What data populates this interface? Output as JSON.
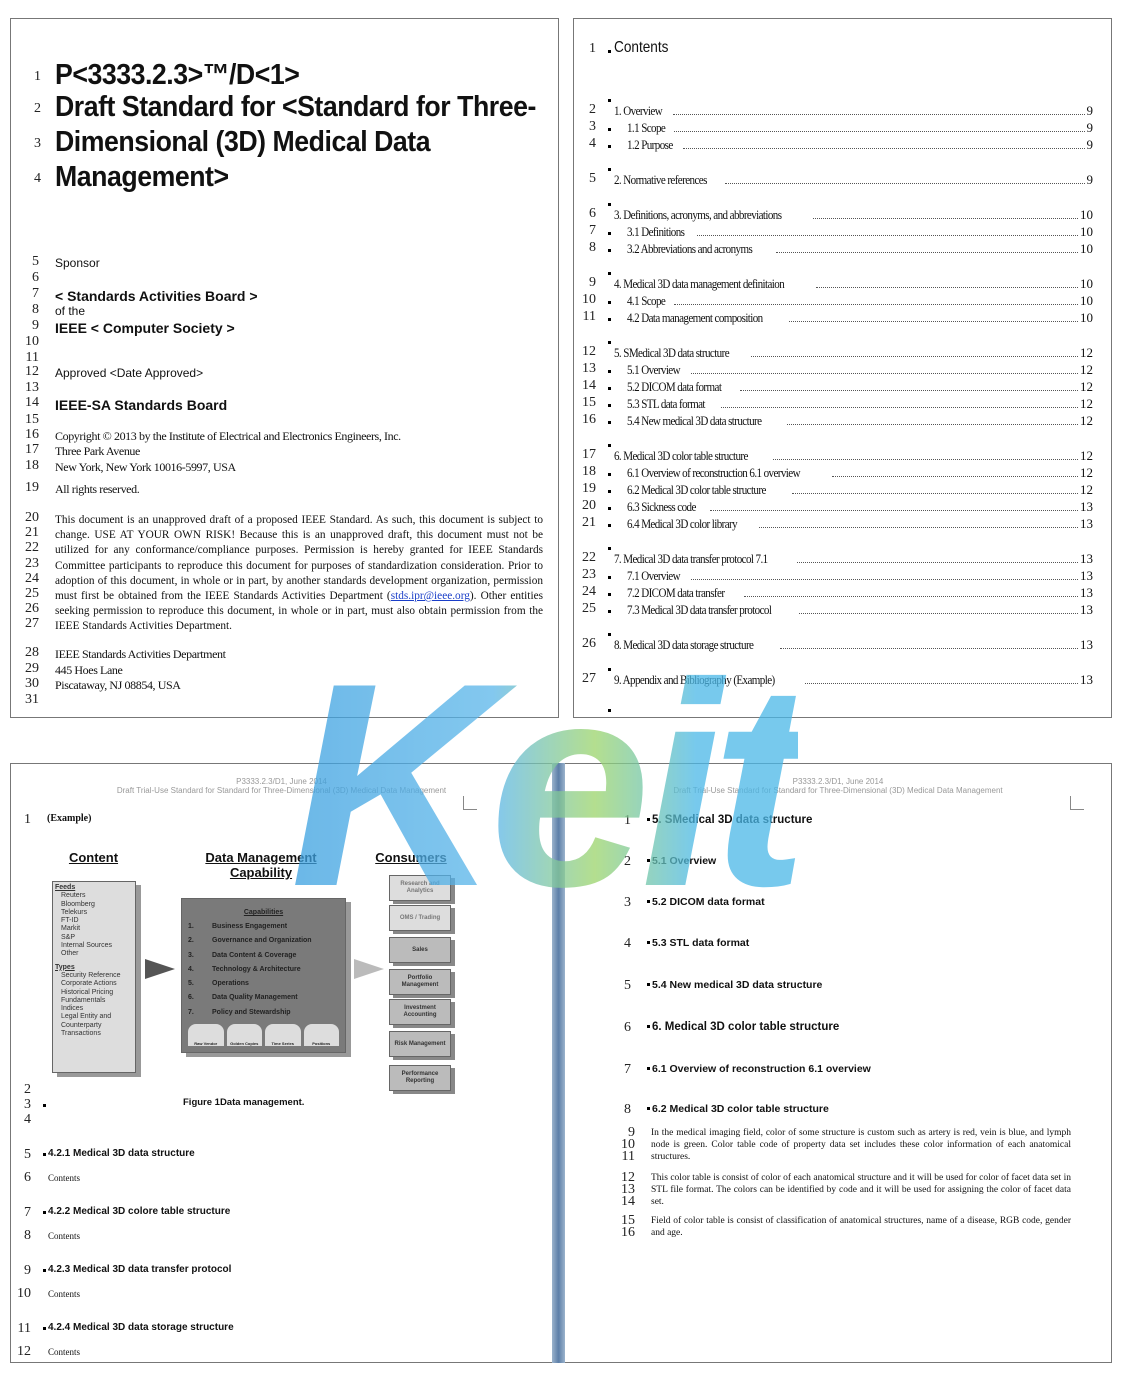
{
  "watermark": {
    "text": "Keit",
    "repeat_text": "KEIT"
  },
  "page1": {
    "title_lines": [
      "P<3333.2.3>™/D<1>",
      "Draft Standard for <Standard for Three-",
      "Dimensional (3D) Medical Data",
      "Management>"
    ],
    "lines": [
      {
        "n": "5",
        "t": "Sponsor"
      },
      {
        "n": "6",
        "t": ""
      },
      {
        "n": "7",
        "t": "< Standards Activities Board >"
      },
      {
        "n": "8",
        "t": "of the"
      },
      {
        "n": "9",
        "t": "IEEE < Computer Society >"
      },
      {
        "n": "10",
        "t": ""
      },
      {
        "n": "11",
        "t": ""
      },
      {
        "n": "12",
        "t": "Approved <Date Approved>"
      },
      {
        "n": "13",
        "t": ""
      },
      {
        "n": "14",
        "t": "IEEE-SA Standards Board"
      },
      {
        "n": "15",
        "t": ""
      },
      {
        "n": "16",
        "t": "Copyright © 2013 by the Institute of Electrical and Electronics Engineers, Inc."
      },
      {
        "n": "17",
        "t": "Three Park Avenue"
      },
      {
        "n": "18",
        "t": "New York, New York 10016-5997, USA"
      },
      {
        "n": "19",
        "t": "All rights reserved."
      }
    ],
    "notice_numbers": [
      "20",
      "21",
      "22",
      "23",
      "24",
      "25",
      "26",
      "27"
    ],
    "notice": "This document is an unapproved draft of a proposed IEEE Standard. As such, this document is subject to change. USE AT YOUR OWN RISK! Because this is an unapproved draft, this document must not be utilized for any conformance/compliance purposes. Permission is hereby granted for IEEE Standards Committee participants to reproduce this document for purposes of standardization consideration. Prior to adoption of this document, in whole or in part, by another standards development organization, permission must first be obtained from the IEEE Standards Activities Department (",
    "notice_link": "stds.ipr@ieee.org",
    "notice_end": "). Other entities seeking permission to reproduce this document, in whole or in part, must also obtain permission from the IEEE Standards Activities Department.",
    "address": [
      {
        "n": "28",
        "t": "IEEE Standards Activities Department"
      },
      {
        "n": "29",
        "t": "445 Hoes Lane"
      },
      {
        "n": "30",
        "t": "Piscataway, NJ 08854, USA"
      },
      {
        "n": "31",
        "t": ""
      }
    ]
  },
  "page2": {
    "heading_num": "1",
    "heading": "Contents",
    "toc": [
      {
        "n": "2",
        "t": "1. Overview",
        "p": "9",
        "lvl": 1
      },
      {
        "n": "3",
        "t": "1.1 Scope",
        "p": "9",
        "lvl": 2
      },
      {
        "n": "4",
        "t": "1.2 Purpose",
        "p": "9",
        "lvl": 2
      },
      {
        "n": "5",
        "t": "2. Normative references",
        "p": "9",
        "lvl": 1
      },
      {
        "n": "6",
        "t": "3. Definitions, acronyms, and abbreviations",
        "p": "10",
        "lvl": 1
      },
      {
        "n": "7",
        "t": "3.1 Definitions",
        "p": "10",
        "lvl": 2
      },
      {
        "n": "8",
        "t": "3.2 Abbreviations and acronyms",
        "p": "10",
        "lvl": 2
      },
      {
        "n": "9",
        "t": "4. Medical 3D data management definitaion",
        "p": "10",
        "lvl": 1
      },
      {
        "n": "10",
        "t": "4.1 Scope",
        "p": "10",
        "lvl": 2
      },
      {
        "n": "11",
        "t": "4.2 Data management composition",
        "p": "10",
        "lvl": 2
      },
      {
        "n": "12",
        "t": "5. SMedical 3D data structure",
        "p": "12",
        "lvl": 1
      },
      {
        "n": "13",
        "t": "5.1 Overview",
        "p": "12",
        "lvl": 2
      },
      {
        "n": "14",
        "t": "5.2 DICOM data format",
        "p": "12",
        "lvl": 2
      },
      {
        "n": "15",
        "t": "5.3 STL data format",
        "p": "12",
        "lvl": 2
      },
      {
        "n": "16",
        "t": "5.4 New medical 3D data structure",
        "p": "12",
        "lvl": 2
      },
      {
        "n": "17",
        "t": "6. Medical 3D color table structure",
        "p": "12",
        "lvl": 1
      },
      {
        "n": "18",
        "t": "6.1 Overview of reconstruction 6.1 overview",
        "p": "12",
        "lvl": 2
      },
      {
        "n": "19",
        "t": "6.2 Medical 3D color table structure",
        "p": "12",
        "lvl": 2
      },
      {
        "n": "20",
        "t": "6.3 Sickness code",
        "p": "13",
        "lvl": 2
      },
      {
        "n": "21",
        "t": "6.4 Medical 3D color library",
        "p": "13",
        "lvl": 2
      },
      {
        "n": "22",
        "t": "7. Medical 3D data transfer protocol 7.1",
        "p": "13",
        "lvl": 1
      },
      {
        "n": "23",
        "t": "7.1 Overview",
        "p": "13",
        "lvl": 2
      },
      {
        "n": "24",
        "t": "7.2 DICOM data transfer",
        "p": "13",
        "lvl": 2
      },
      {
        "n": "25",
        "t": "7.3 Medical 3D data transfer protocol",
        "p": "13",
        "lvl": 2
      },
      {
        "n": "26",
        "t": "8. Medical 3D data storage structure",
        "p": "13",
        "lvl": 1
      },
      {
        "n": "27",
        "t": "9. Appendix and Bibliography (Example)",
        "p": "13",
        "lvl": 1
      }
    ]
  },
  "running_header": {
    "line1": "P3333.2.3/D1, June 2014",
    "line2_left": "Draft Trial-Use Standard for Standard for Three-Dimensional (3D) Medical Data Management",
    "line2_right": "Draft Trial-Use Standard for Standard for Three-Dimensional (3D) Medical Data Management"
  },
  "page3": {
    "example_label": "(Example)",
    "figure": {
      "content_title": "Content",
      "dm_title": "Data Management Capability",
      "consumers_title": "Consumers",
      "feeds_label": "Feeds",
      "feeds": [
        "Reuters",
        "Bloomberg",
        "Telekurs",
        "FT-ID",
        "Markit",
        "S&P",
        "Internal Sources",
        "Other"
      ],
      "types_label": "Types",
      "types": [
        "Security Reference",
        "Corporate Actions",
        "Historical Pricing",
        "Fundamentals",
        "Indices",
        "Legal Entity and Counterparty",
        "Transactions"
      ],
      "capabilities_label": "Capabilities",
      "capabilities": [
        "Business Engagement",
        "Governance and Organization",
        "Data Content & Coverage",
        "Technology & Architecture",
        "Operations",
        "Data Quality Management",
        "Policy and Stewardship"
      ],
      "stores": [
        "Raw Vendor",
        "Golden Copies",
        "Time Series",
        "Positions"
      ],
      "consumers": [
        "Research and Analytics",
        "OMS / Trading",
        "Sales",
        "Portfolio Management",
        "Investment Accounting",
        "Risk Management",
        "Performance Reporting"
      ]
    },
    "caption": "Figure 1Data management.",
    "sections": [
      {
        "n": "5",
        "t": "4.2.1 Medical 3D data structure",
        "cn": "6",
        "c": "Contents"
      },
      {
        "n": "7",
        "t": "4.2.2 Medical 3D colore table structure",
        "cn": "8",
        "c": "Contents"
      },
      {
        "n": "9",
        "t": "4.2.3 Medical 3D data transfer protocol",
        "cn": "10",
        "c": "Contents"
      },
      {
        "n": "11",
        "t": "4.2.4 Medical 3D data storage structure",
        "cn": "12",
        "c": "Contents"
      }
    ]
  },
  "page4": {
    "headings": [
      {
        "n": "1",
        "t": "5. SMedical 3D data structure",
        "major": true
      },
      {
        "n": "2",
        "t": "5.1 Overview",
        "major": false
      },
      {
        "n": "3",
        "t": "5.2 DICOM data format",
        "major": false
      },
      {
        "n": "4",
        "t": "5.3 STL data format",
        "major": false
      },
      {
        "n": "5",
        "t": "5.4 New medical 3D data structure",
        "major": false
      },
      {
        "n": "6",
        "t": "6. Medical 3D color table structure",
        "major": true
      },
      {
        "n": "7",
        "t": "6.1 Overview of reconstruction 6.1 overview",
        "major": false
      },
      {
        "n": "8",
        "t": "6.2 Medical 3D color table structure",
        "major": false
      }
    ],
    "paragraphs": [
      {
        "nums": [
          "9",
          "10",
          "11"
        ],
        "t": "In the medical imaging field, color of some structure is custom such as artery is red, vein is blue, and lymph node is green. Color table code of property data set includes these color information of each anatomical structures."
      },
      {
        "nums": [
          "12",
          "13",
          "14"
        ],
        "t": "This color table is consist of color of each anatomical structure and it will be used for color of facet data set in STL file format. The colors can be identified by code and it will be used for assigning the color of facet data set."
      },
      {
        "nums": [
          "15",
          "16"
        ],
        "t": "Field of color table is consist of classification of anatomical structures, name of a disease, RGB code, gender and age."
      }
    ]
  }
}
